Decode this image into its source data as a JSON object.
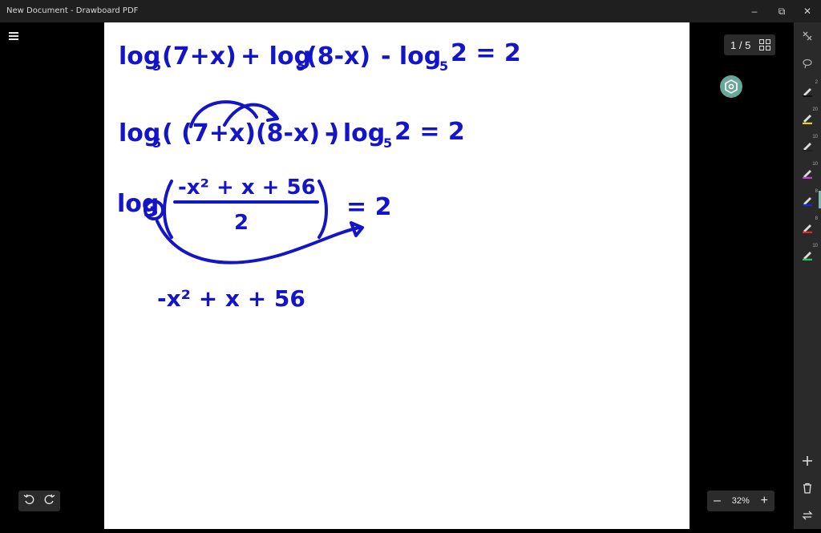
{
  "window": {
    "title": "New Document - Drawboard PDF",
    "minimize": "–",
    "restore": "⧉",
    "close": "✕"
  },
  "page_indicator": {
    "text": "1 / 5"
  },
  "zoom": {
    "level": "32%",
    "minus": "–",
    "plus": "+"
  },
  "tools": [
    {
      "name": "select-tool",
      "size": ""
    },
    {
      "name": "lasso-tool",
      "size": ""
    },
    {
      "name": "pen-tool",
      "size": "2"
    },
    {
      "name": "highlighter-tool",
      "size": "20"
    },
    {
      "name": "pen-tool-2",
      "size": "10"
    },
    {
      "name": "pen-tool-purple",
      "size": "10"
    },
    {
      "name": "pen-tool-blue",
      "size": "8"
    },
    {
      "name": "pen-tool-red",
      "size": "8"
    },
    {
      "name": "pen-tool-green",
      "size": "10"
    }
  ],
  "handwriting": {
    "line1_a": "log",
    "line1_a_sub": "5",
    "line1_b": "(7+x)",
    "line1_c": "+ log",
    "line1_c_sub": "5",
    "line1_d": "(8-x)",
    "line1_e": "- log",
    "line1_e_sub": "5",
    "line1_f": "2 = 2",
    "line2_a": "log",
    "line2_a_sub": "5",
    "line2_b": "( (7+x)(8-x) )",
    "line2_c": "- log",
    "line2_c_sub": "5",
    "line2_d": "2 = 2",
    "line3_a": "log",
    "line3_a_sub": "5",
    "line3_num": "-x² + x + 56",
    "line3_den": "2",
    "line3_eq": "= 2",
    "line4": "-x² + x + 56"
  }
}
